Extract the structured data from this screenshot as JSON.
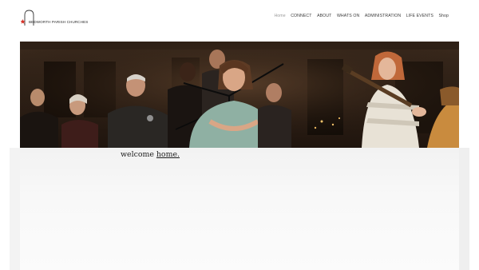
{
  "header": {
    "logo_text": "BEDWORTH PARISH CHURCHES"
  },
  "nav": {
    "items": [
      {
        "label": "Home",
        "active": true
      },
      {
        "label": "CONNECT",
        "active": false
      },
      {
        "label": "ABOUT",
        "active": false
      },
      {
        "label": "WHATS ON",
        "active": false
      },
      {
        "label": "ADMINISTRATION",
        "active": false
      },
      {
        "label": "LIFE EVENTS",
        "active": false
      },
      {
        "label": "Shop",
        "active": false
      }
    ]
  },
  "main": {
    "welcome_prefix": "welcome",
    "welcome_link": "home."
  },
  "colors": {
    "logo_red": "#d8332a",
    "hero_dark": "#2a1c12"
  }
}
